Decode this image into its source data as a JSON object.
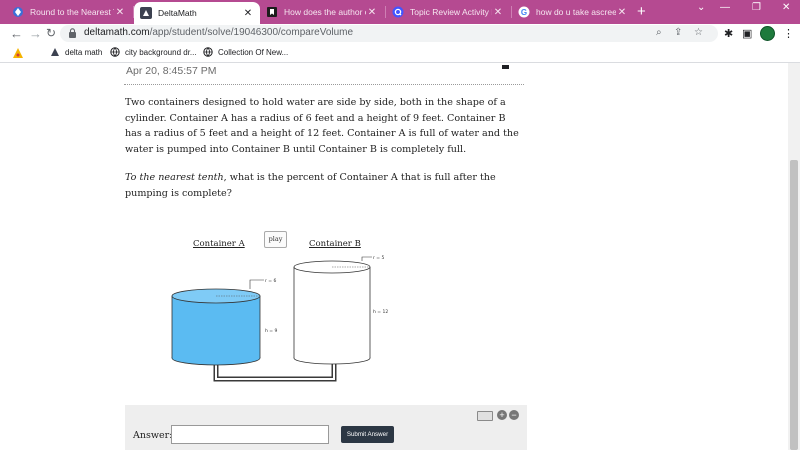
{
  "browser": {
    "tabs": [
      {
        "title": "Round to the Nearest Th...",
        "icon": "diamond-icon",
        "active": false
      },
      {
        "title": "DeltaMath",
        "icon": "deltamath-icon",
        "active": true
      },
      {
        "title": "How does the author of \"T",
        "icon": "bookmark-icon",
        "active": false
      },
      {
        "title": "Topic Review Activity Flag",
        "icon": "quizlet-icon",
        "active": false
      },
      {
        "title": "how do u take ascreensh...",
        "icon": "google-icon",
        "active": false
      }
    ],
    "url_domain": "deltamath.com",
    "url_path": "/app/student/solve/19046300/compareVolume",
    "bookmarks": [
      {
        "label": "",
        "icon": "extension-icon"
      },
      {
        "label": "delta math",
        "icon": "deltamath-icon"
      },
      {
        "label": "city background dr...",
        "icon": "globe-icon"
      },
      {
        "label": "Collection Of New...",
        "icon": "globe-icon"
      }
    ],
    "colors": {
      "tabstrip": "#b54a91",
      "profile": "#1e7a3c"
    }
  },
  "problem": {
    "timestamp": "Apr 20, 8:45:57 PM",
    "question": "Two containers designed to hold water are side by side, both in the shape of a cylinder. Container A has a radius of 6 feet and a height of 9 feet. Container B has a radius of 5 feet and a height of 12 feet. Container A is full of water and the water is pumped into Container B until Container B is completely full.",
    "prompt_italic": "To the nearest tenth",
    "prompt_rest": ", what is the percent of Container A that is full after the pumping is complete?"
  },
  "diagram": {
    "container_a_label": "Container A",
    "container_b_label": "Container B",
    "play_label": "play",
    "a_radius_label": "r = 6",
    "a_height_label": "h = 9",
    "b_radius_label": "r = 5",
    "b_height_label": "h = 12",
    "water_color": "#5bbbf2"
  },
  "answer": {
    "label": "Answer:",
    "value": "",
    "submit_label": "Submit Answer"
  }
}
